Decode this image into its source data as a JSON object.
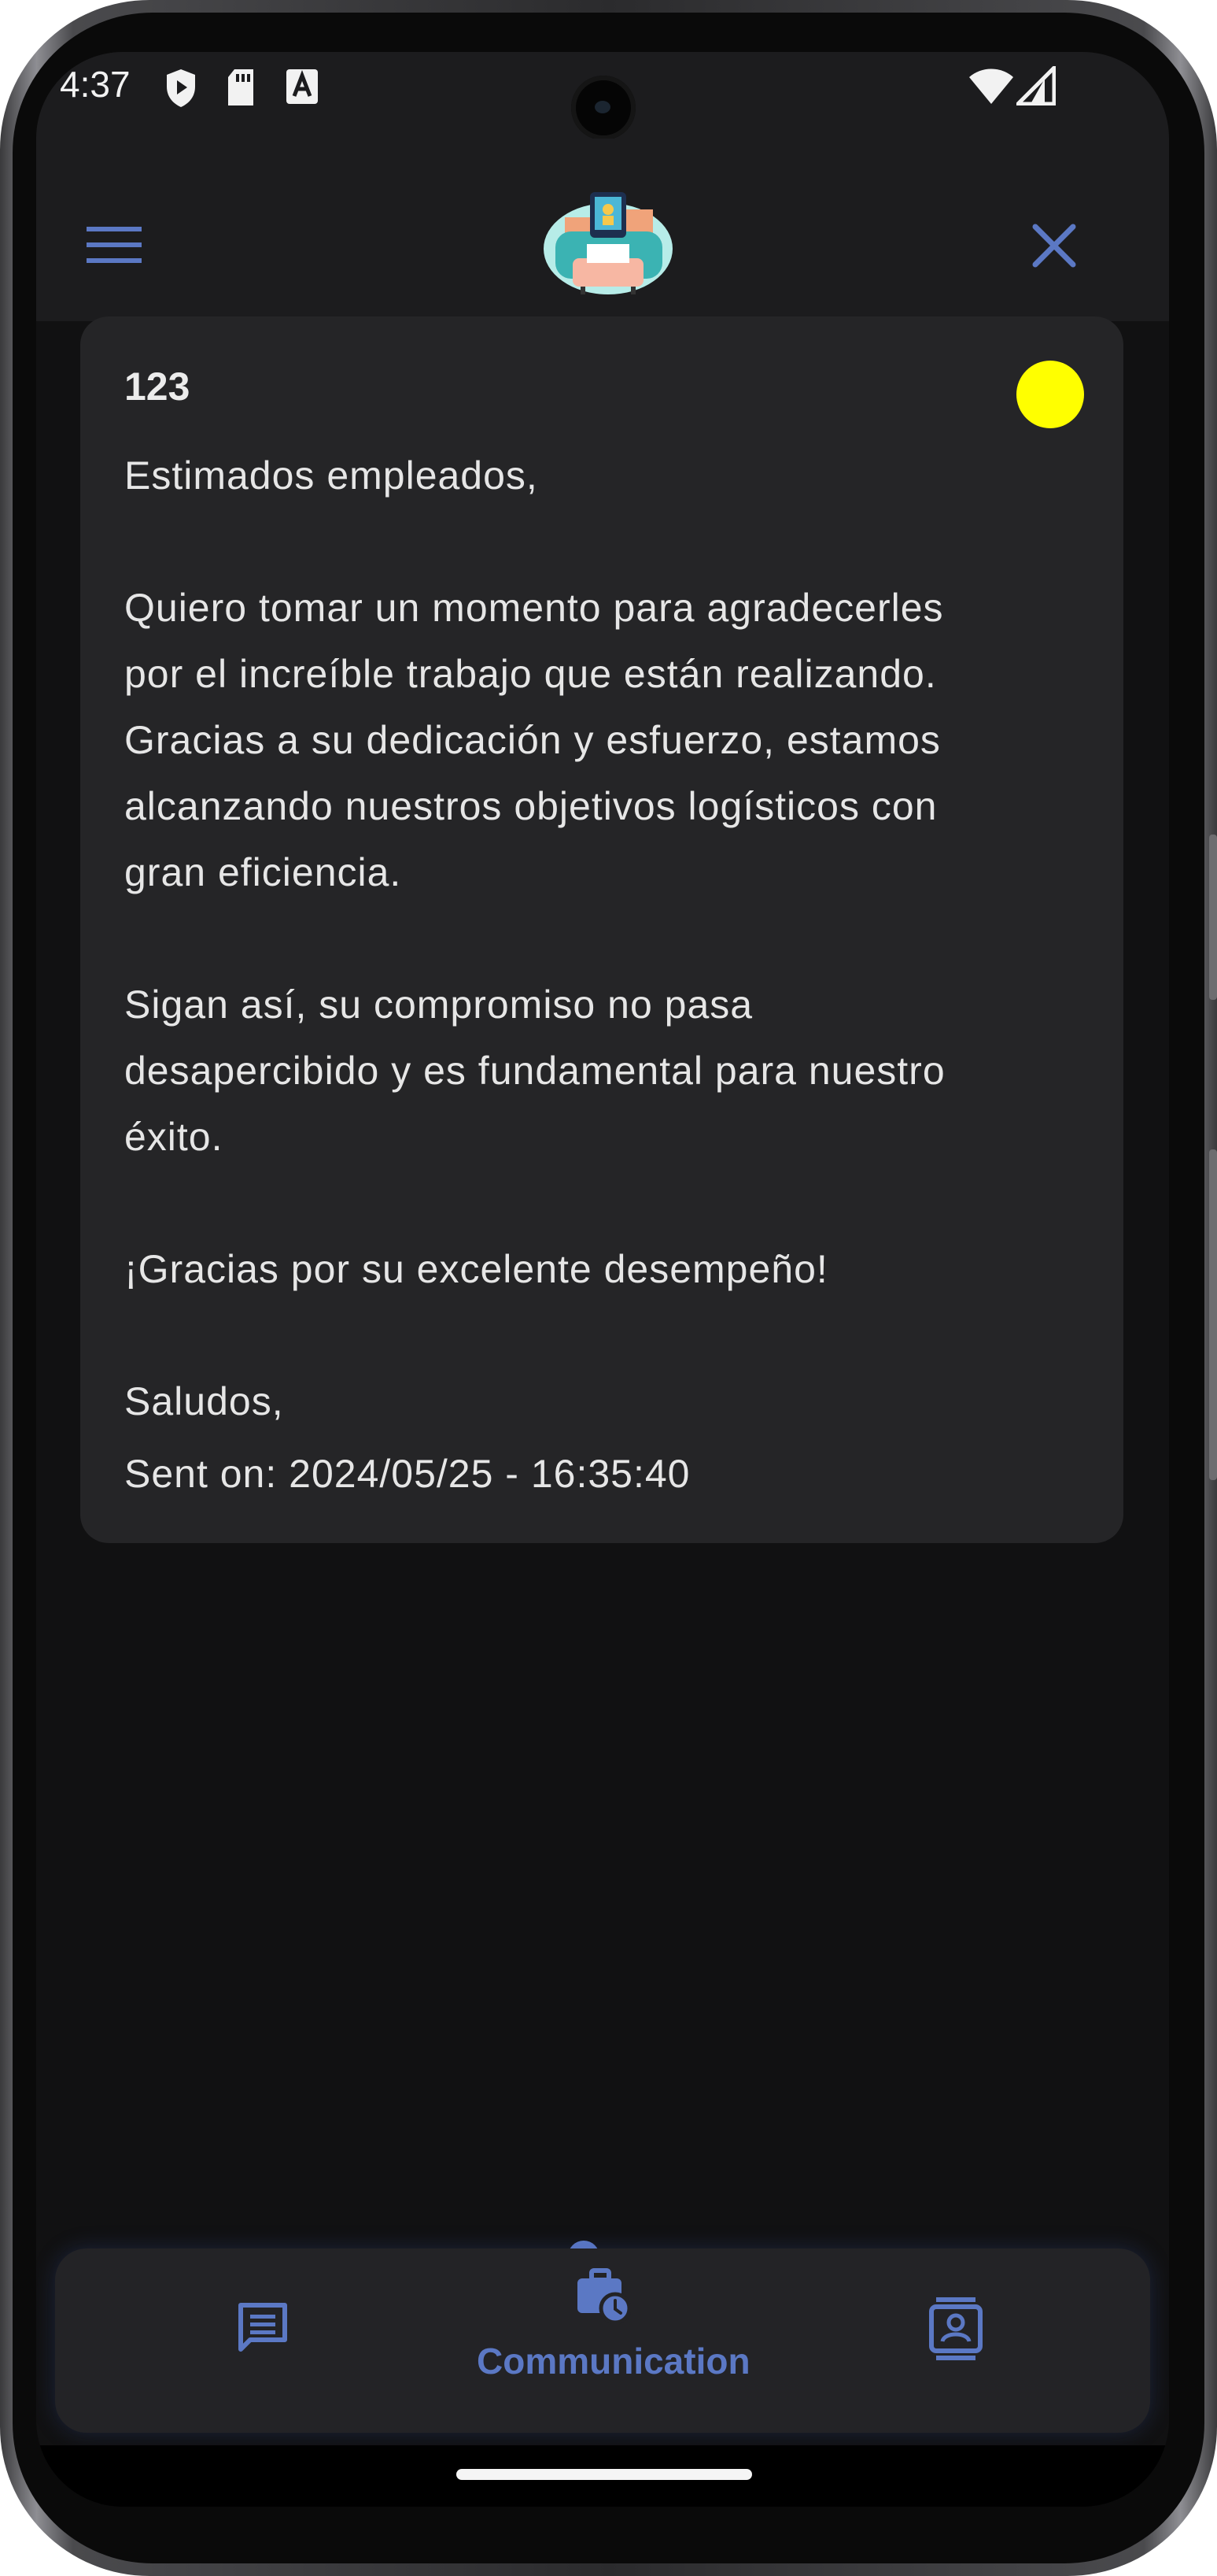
{
  "status_bar": {
    "time": "4:37",
    "icons": [
      "shield-play-icon",
      "sd-card-icon",
      "font-a-icon",
      "wifi-icon",
      "signal-icon"
    ]
  },
  "app_bar": {
    "menu_icon": "hamburger-menu-icon",
    "logo": "app-logo",
    "close_icon": "close-icon",
    "accent_color": "#5b78c4"
  },
  "message": {
    "title": "123",
    "unread_indicator_color": "#ffff00",
    "greeting": "Estimados empleados,",
    "paragraph1_lines": [
      "Quiero tomar un momento para agradecerles",
      "por el increíble trabajo que están realizando.",
      "Gracias a su dedicación y esfuerzo, estamos",
      "alcanzando nuestros objetivos logísticos con",
      "gran eficiencia."
    ],
    "paragraph2_lines": [
      "Sigan así, su compromiso no pasa",
      "desapercibido y es fundamental para nuestro",
      "éxito."
    ],
    "closing_thanks": "¡Gracias por su excelente desempeño!",
    "signoff": "Saludos,",
    "sent_on": "Sent on: 2024/05/25 - 16:35:40"
  },
  "bottom_nav": {
    "items": [
      {
        "icon": "chat-message-icon",
        "label": ""
      },
      {
        "icon": "briefcase-clock-icon",
        "label": "Communication",
        "selected": true
      },
      {
        "icon": "contact-card-icon",
        "label": ""
      }
    ]
  },
  "colors": {
    "background": "#111112",
    "card": "#252527",
    "text": "#e6e6e6"
  }
}
